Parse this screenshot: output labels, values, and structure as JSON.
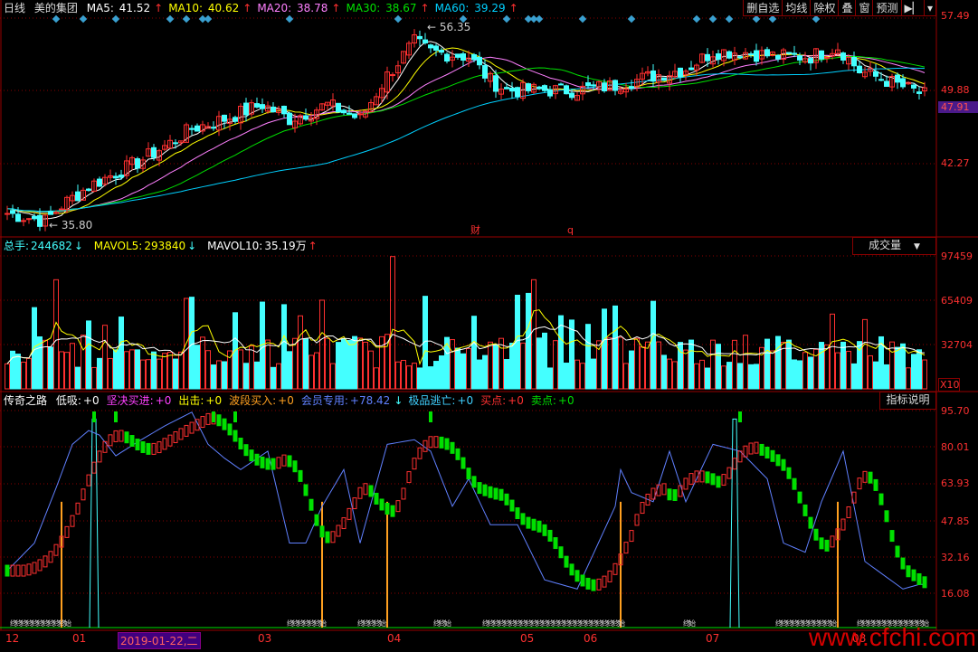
{
  "header": {
    "period": "日线",
    "stock": "美的集团",
    "ma": [
      {
        "label": "MA5:",
        "value": "41.52",
        "color": "#ffffff"
      },
      {
        "label": "MA10:",
        "value": "40.62",
        "color": "#ffff00"
      },
      {
        "label": "MA20:",
        "value": "38.78",
        "color": "#ff80ff"
      },
      {
        "label": "MA30:",
        "value": "38.67",
        "color": "#00e000"
      },
      {
        "label": "MA60:",
        "value": "39.29",
        "color": "#00d0ff"
      }
    ],
    "arrow_up": "↑",
    "arrow_down": "↓"
  },
  "toolbar": [
    "删自选",
    "均线",
    "除权",
    "叠",
    "窗",
    "预测",
    "▶▏",
    "▾"
  ],
  "price_axis": [
    "57.49",
    "49.88",
    "42.27"
  ],
  "current_price": "47.91",
  "high_label": "56.35",
  "low_label": "35.80",
  "event_marks": [
    "财",
    "q"
  ],
  "volume": {
    "label": "总手:",
    "value": "244682",
    "mavol5_label": "MAVOL5:",
    "mavol5": "293840",
    "mavol10_label": "MAVOL10:",
    "mavol10": "35.19万",
    "selector": "成交量",
    "axis": [
      "97459",
      "65409",
      "32704"
    ],
    "unit": "X10"
  },
  "indicator": {
    "name": "传奇之路",
    "items": [
      {
        "label": "低吸:",
        "value": "+0",
        "color": "#ffffff"
      },
      {
        "label": "坚决买进:",
        "value": "+0",
        "color": "#ff40ff"
      },
      {
        "label": "出击:",
        "value": "+0",
        "color": "#ffff00"
      },
      {
        "label": "波段买入:",
        "value": "+0",
        "color": "#ffa020"
      },
      {
        "label": "会员专用:",
        "value": "+78.42",
        "color": "#6080ff"
      },
      {
        "label": "极品逃亡:",
        "value": "+0",
        "color": "#40d0ff"
      },
      {
        "label": "买点:",
        "value": "+0",
        "color": "#ff3030"
      },
      {
        "label": "卖点:",
        "value": "+0",
        "color": "#00e000"
      }
    ],
    "explain": "指标说明",
    "axis": [
      "95.70",
      "80.01",
      "63.93",
      "47.85",
      "32.16",
      "16.08"
    ]
  },
  "dates": [
    {
      "t": "12"
    },
    {
      "t": "01"
    },
    {
      "t": "2019-01-22,二",
      "selected": true
    },
    {
      "t": "03"
    },
    {
      "t": "04"
    },
    {
      "t": "05"
    },
    {
      "t": "06"
    },
    {
      "t": "07"
    },
    {
      "t": "08"
    }
  ],
  "bottom_marks": {
    "start": "始",
    "end": "终"
  },
  "watermark": "www.cfchi.com",
  "chart_data": {
    "type": "candlestick",
    "price_range": [
      33.5,
      58.5
    ],
    "price_keypoints": [
      [
        0,
        37.2
      ],
      [
        7,
        36.4
      ],
      [
        10,
        38
      ],
      [
        15,
        40
      ],
      [
        24,
        42.5
      ],
      [
        30,
        44.5
      ],
      [
        34,
        46
      ],
      [
        40,
        47
      ],
      [
        47,
        48.5
      ],
      [
        52,
        47
      ],
      [
        59,
        48.5
      ],
      [
        65,
        47
      ],
      [
        70,
        51.5
      ],
      [
        75,
        55
      ],
      [
        78,
        54
      ],
      [
        85,
        53.5
      ],
      [
        89,
        51
      ],
      [
        92,
        50
      ],
      [
        100,
        50
      ],
      [
        105,
        50
      ],
      [
        112,
        50.5
      ],
      [
        119,
        51.5
      ],
      [
        125,
        52.2
      ],
      [
        130,
        54
      ],
      [
        135,
        54
      ],
      [
        142,
        53.5
      ],
      [
        148,
        53.5
      ],
      [
        153,
        54.5
      ],
      [
        157,
        52
      ],
      [
        162,
        51
      ],
      [
        169,
        49.5
      ]
    ],
    "signal_days": [
      9,
      14,
      20,
      30,
      33,
      36,
      37,
      52,
      72,
      84,
      92,
      96,
      97,
      98,
      106,
      115,
      127,
      130,
      133,
      138,
      141,
      149
    ],
    "volume_max": 97459,
    "indicator_keypoints": [
      [
        0,
        26
      ],
      [
        5,
        38
      ],
      [
        9,
        62
      ],
      [
        12,
        81
      ],
      [
        15,
        87
      ],
      [
        17,
        85
      ],
      [
        20,
        76
      ],
      [
        24,
        82
      ],
      [
        29,
        89
      ],
      [
        34,
        95
      ],
      [
        37,
        81
      ],
      [
        40,
        75
      ],
      [
        43,
        70
      ],
      [
        48,
        78
      ],
      [
        52,
        38
      ],
      [
        55,
        38
      ],
      [
        58,
        54
      ],
      [
        62,
        70
      ],
      [
        65,
        38
      ],
      [
        70,
        81
      ],
      [
        75,
        83
      ],
      [
        78,
        78
      ],
      [
        82,
        54
      ],
      [
        85,
        66
      ],
      [
        89,
        46
      ],
      [
        94,
        46
      ],
      [
        99,
        22
      ],
      [
        105,
        18
      ],
      [
        112,
        54
      ],
      [
        113,
        70
      ],
      [
        115,
        60
      ],
      [
        119,
        56
      ],
      [
        122,
        78
      ],
      [
        125,
        56
      ],
      [
        130,
        81
      ],
      [
        135,
        78
      ],
      [
        140,
        66
      ],
      [
        143,
        38
      ],
      [
        147,
        34
      ],
      [
        150,
        56
      ],
      [
        154,
        78
      ],
      [
        158,
        30
      ],
      [
        165,
        18
      ],
      [
        168,
        20
      ]
    ],
    "buy_days": [
      10,
      58,
      70,
      113,
      153
    ],
    "spike_days": [
      16,
      134
    ],
    "top_marks": [
      16,
      20,
      38,
      42,
      78,
      135
    ]
  }
}
